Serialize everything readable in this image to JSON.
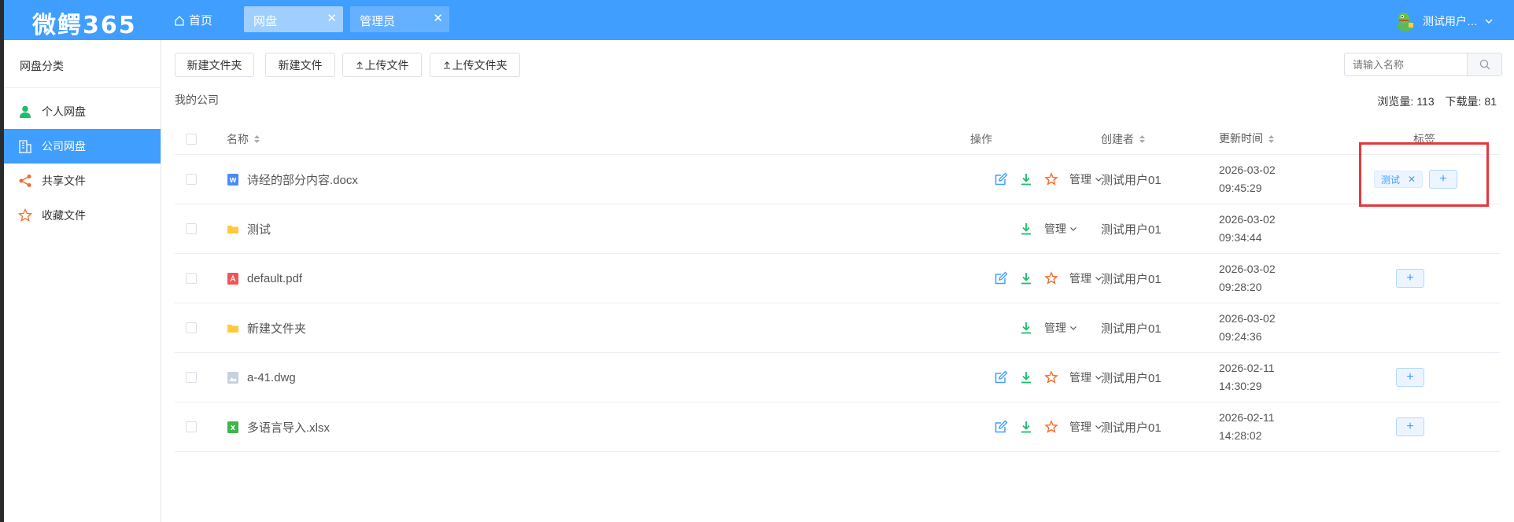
{
  "header": {
    "logo": "微鳄365",
    "home": "首页",
    "tabs": [
      {
        "label": "网盘"
      },
      {
        "label": "管理员"
      }
    ],
    "user": "测试用户…"
  },
  "sidebar": {
    "title": "网盘分类",
    "items": [
      {
        "label": "个人网盘",
        "icon": "user-icon"
      },
      {
        "label": "公司网盘",
        "icon": "building-icon",
        "active": true
      },
      {
        "label": "共享文件",
        "icon": "share-icon"
      },
      {
        "label": "收藏文件",
        "icon": "star-icon"
      }
    ]
  },
  "toolbar": {
    "new_folder": "新建文件夹",
    "new_file": "新建文件",
    "upload_file": "上传文件",
    "upload_folder": "上传文件夹"
  },
  "search": {
    "placeholder": "请输入名称"
  },
  "breadcrumb": "我的公司",
  "stats": {
    "views_label": "浏览量:",
    "views": "113",
    "downloads_label": "下载量:",
    "downloads": "81"
  },
  "table": {
    "columns": {
      "name": "名称",
      "ops": "操作",
      "creator": "创建者",
      "updated": "更新时间",
      "tags": "标签"
    },
    "manage_label": "管理",
    "rows": [
      {
        "name": "诗经的部分内容.docx",
        "type": "word",
        "creator": "测试用户01",
        "date": "2026-03-02",
        "time": "09:45:29",
        "tag": "测试",
        "edit": true,
        "fav": true,
        "add_tag": true
      },
      {
        "name": "测试",
        "type": "folder",
        "creator": "测试用户01",
        "date": "2026-03-02",
        "time": "09:34:44",
        "edit": false,
        "fav": false,
        "add_tag": false
      },
      {
        "name": "default.pdf",
        "type": "pdf",
        "creator": "测试用户01",
        "date": "2026-03-02",
        "time": "09:28:20",
        "edit": true,
        "fav": true,
        "add_tag": true
      },
      {
        "name": "新建文件夹",
        "type": "folder",
        "creator": "测试用户01",
        "date": "2026-03-02",
        "time": "09:24:36",
        "edit": false,
        "fav": false,
        "add_tag": false
      },
      {
        "name": "a-41.dwg",
        "type": "image",
        "creator": "测试用户01",
        "date": "2026-02-11",
        "time": "14:30:29",
        "edit": true,
        "fav": true,
        "add_tag": true
      },
      {
        "name": "多语言导入.xlsx",
        "type": "excel",
        "creator": "测试用户01",
        "date": "2026-02-11",
        "time": "14:28:02",
        "edit": true,
        "fav": true,
        "add_tag": true
      }
    ]
  },
  "colors": {
    "primary": "#409eff",
    "download": "#19be6b",
    "favorite": "#f56c2b",
    "highlight": "#e4393c"
  }
}
